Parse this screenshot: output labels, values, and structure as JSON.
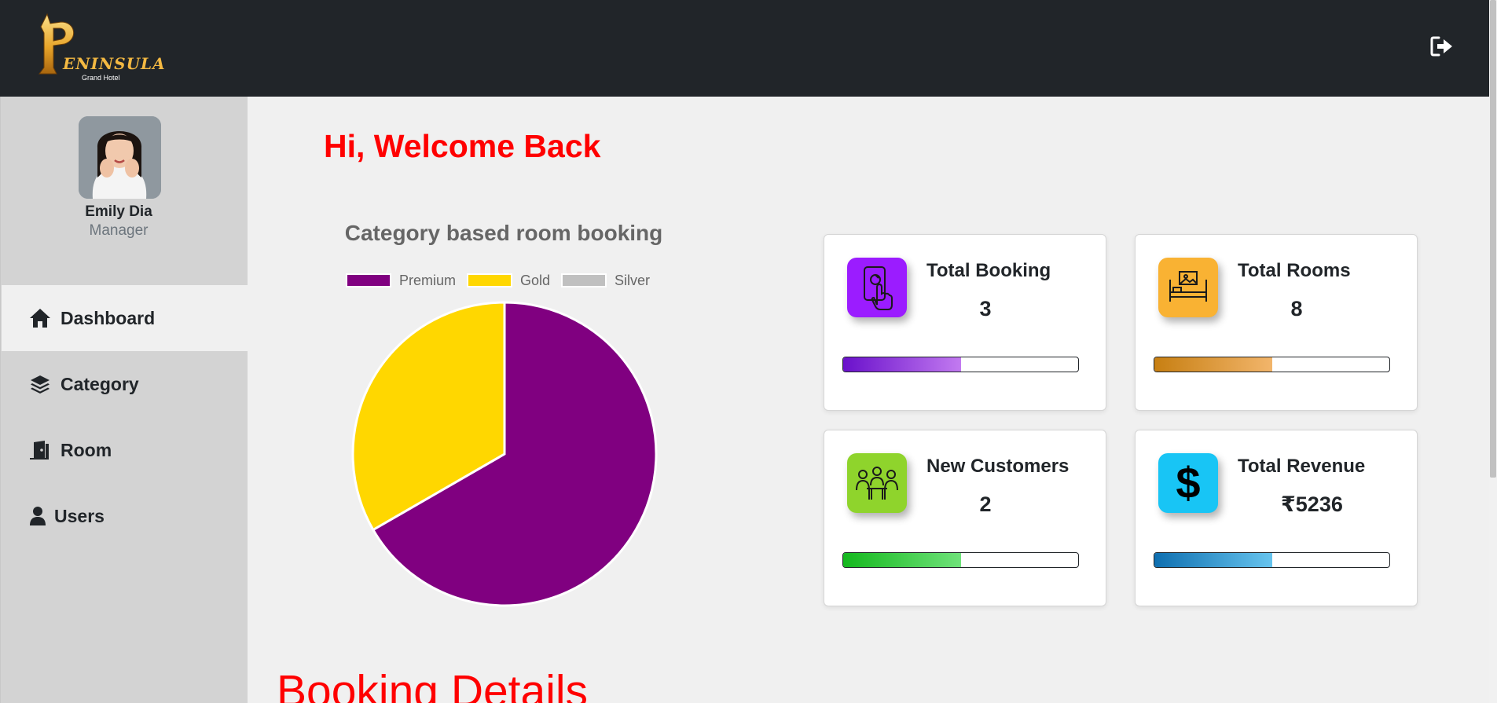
{
  "header": {
    "logo_text": "ENINSULA",
    "logo_initial": "P",
    "logo_subtitle": "Grand Hotel",
    "logout_icon": "logout-icon"
  },
  "sidebar": {
    "user": {
      "name": "Emily Dia",
      "role": "Manager"
    },
    "items": [
      {
        "label": "Dashboard",
        "icon": "home-icon",
        "active": true
      },
      {
        "label": "Category",
        "icon": "layers-icon",
        "active": false
      },
      {
        "label": "Room",
        "icon": "door-icon",
        "active": false
      },
      {
        "label": "Users",
        "icon": "user-icon",
        "active": false
      }
    ]
  },
  "main": {
    "welcome": "Hi, Welcome Back",
    "booking_heading": "Booking Details"
  },
  "chart_data": {
    "type": "pie",
    "title": "Category based room booking",
    "categories": [
      "Premium",
      "Gold",
      "Silver"
    ],
    "values": [
      2,
      1,
      0
    ],
    "colors": [
      "#800080",
      "#ffd700",
      "#c0c0c0"
    ],
    "legend": "top"
  },
  "cards": [
    {
      "title": "Total Booking",
      "value": "3",
      "icon": "phone-touch-icon",
      "icon_bg": "#9b1cff",
      "progress": 0.5,
      "bar_from": "#6a11cb",
      "bar_to": "#c27af0"
    },
    {
      "title": "Total Rooms",
      "value": "8",
      "icon": "bed-icon",
      "icon_bg": "#f9b233",
      "progress": 0.5,
      "bar_from": "#c77f12",
      "bar_to": "#f2b56b"
    },
    {
      "title": "New Customers",
      "value": "2",
      "icon": "customers-icon",
      "icon_bg": "#8fd42c",
      "progress": 0.5,
      "bar_from": "#14b81e",
      "bar_to": "#6fe27a"
    },
    {
      "title": "Total Revenue",
      "value": "₹5236",
      "icon": "dollar-icon",
      "icon_bg": "#18c5f5",
      "progress": 0.5,
      "bar_from": "#0e6fb0",
      "bar_to": "#67c4ee"
    }
  ]
}
